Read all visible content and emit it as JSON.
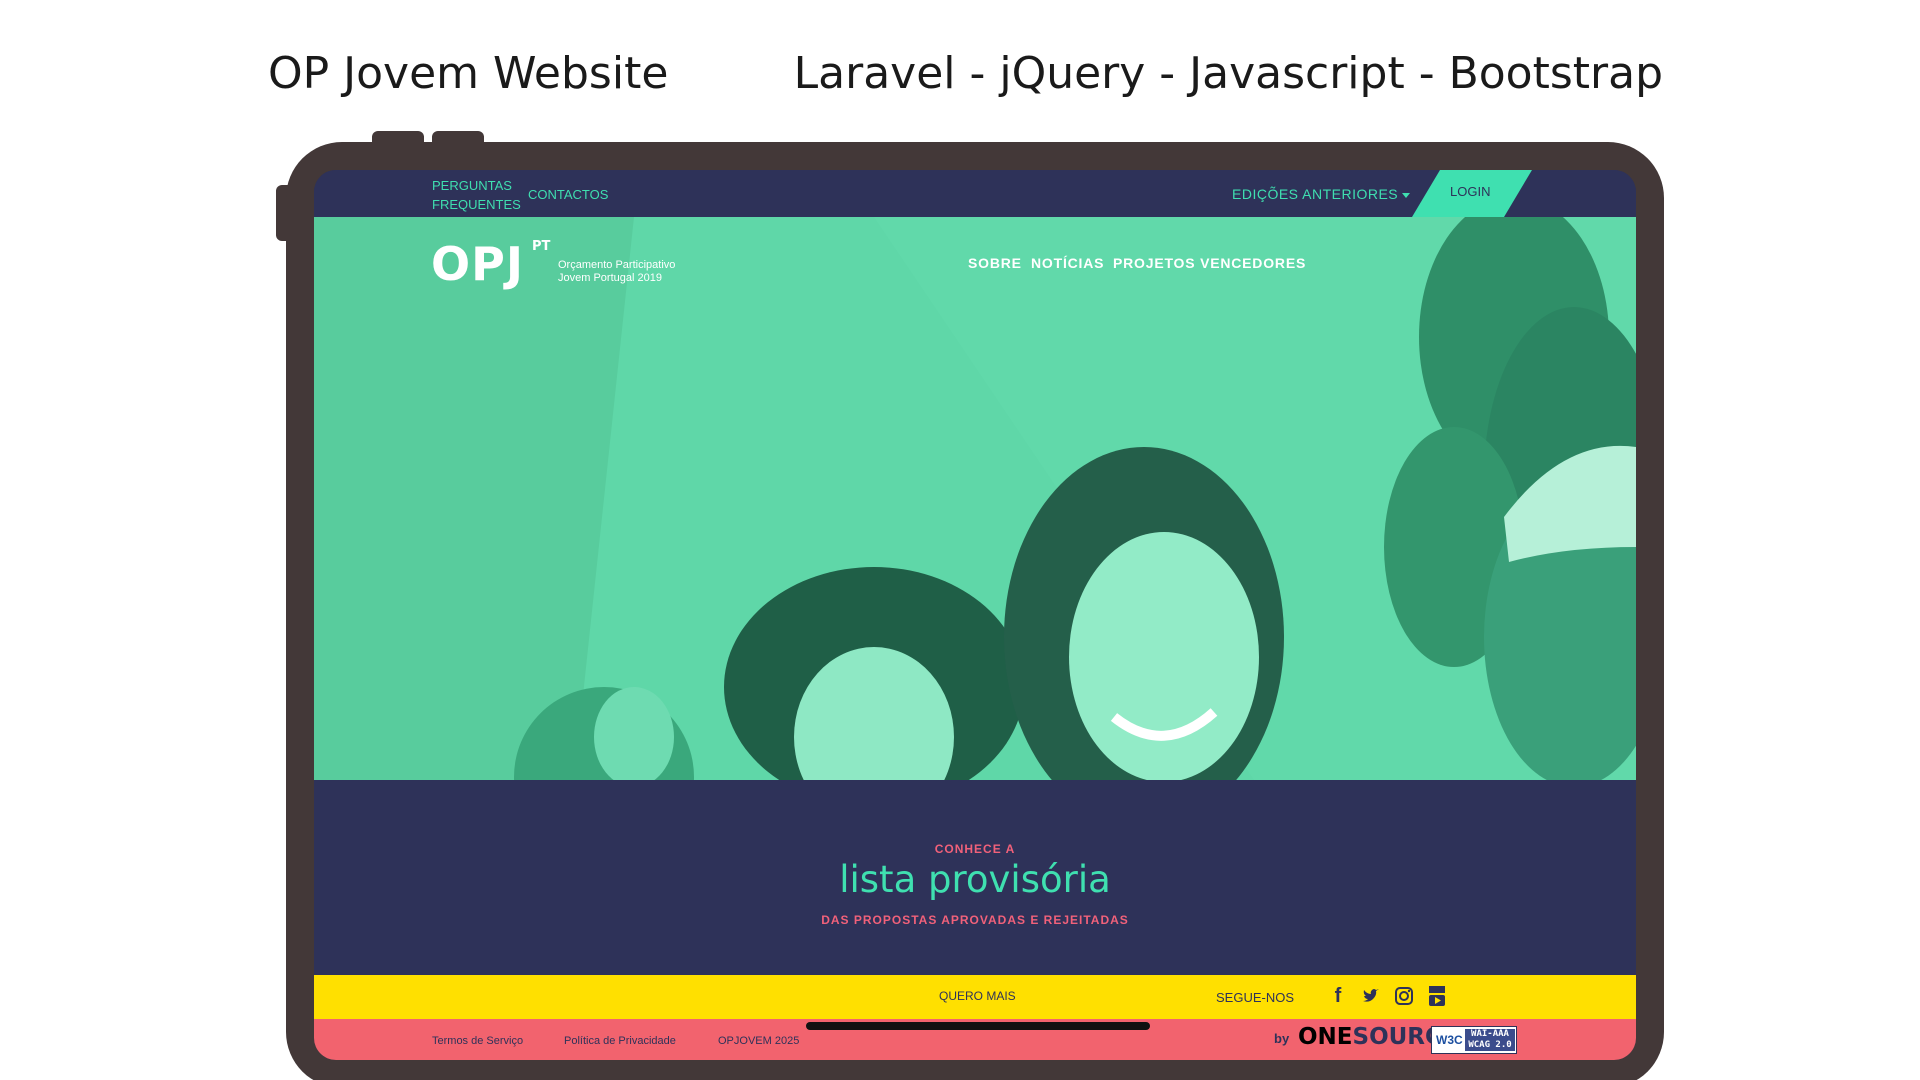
{
  "captions": {
    "project": "OP Jovem Website",
    "stack": "Laravel - jQuery - Javascript - Bootstrap"
  },
  "topbar": {
    "faq": "PERGUNTAS FREQUENTES",
    "contacts": "CONTACTOS",
    "previous_editions": "EDIÇÕES ANTERIORES",
    "login": "LOGIN"
  },
  "logo": {
    "mark": "OPJ",
    "pt": "PT",
    "subtitle": "Orçamento Participativo Jovem Portugal 2019"
  },
  "nav": {
    "items": [
      "SOBRE",
      "NOTÍCIAS",
      "PROJETOS VENCEDORES"
    ]
  },
  "hero_text": {
    "kicker": "CONHECE A",
    "headline": "lista provisória",
    "subline": "DAS PROPOSTAS APROVADAS E REJEITADAS"
  },
  "strip": {
    "more": "QUERO MAIS",
    "follow": "SEGUE-NOS",
    "social_icons": [
      "facebook-icon",
      "twitter-icon",
      "instagram-icon",
      "youtube-icon"
    ]
  },
  "footer": {
    "terms": "Termos de Serviço",
    "privacy": "Política de Privacidade",
    "copyright": "OPJOVEM 2025",
    "by": "by",
    "brand_one": "ONE",
    "brand_source": "SOURCE",
    "w3c_logo": "W3C",
    "w3c_level_1": "WAI-AAA",
    "w3c_level_2": "WCAG 2.0"
  },
  "colors": {
    "navy": "#2e3259",
    "mint": "#3fe0b0",
    "yellow": "#ffe000",
    "coral": "#f2636e",
    "device": "#433838"
  }
}
